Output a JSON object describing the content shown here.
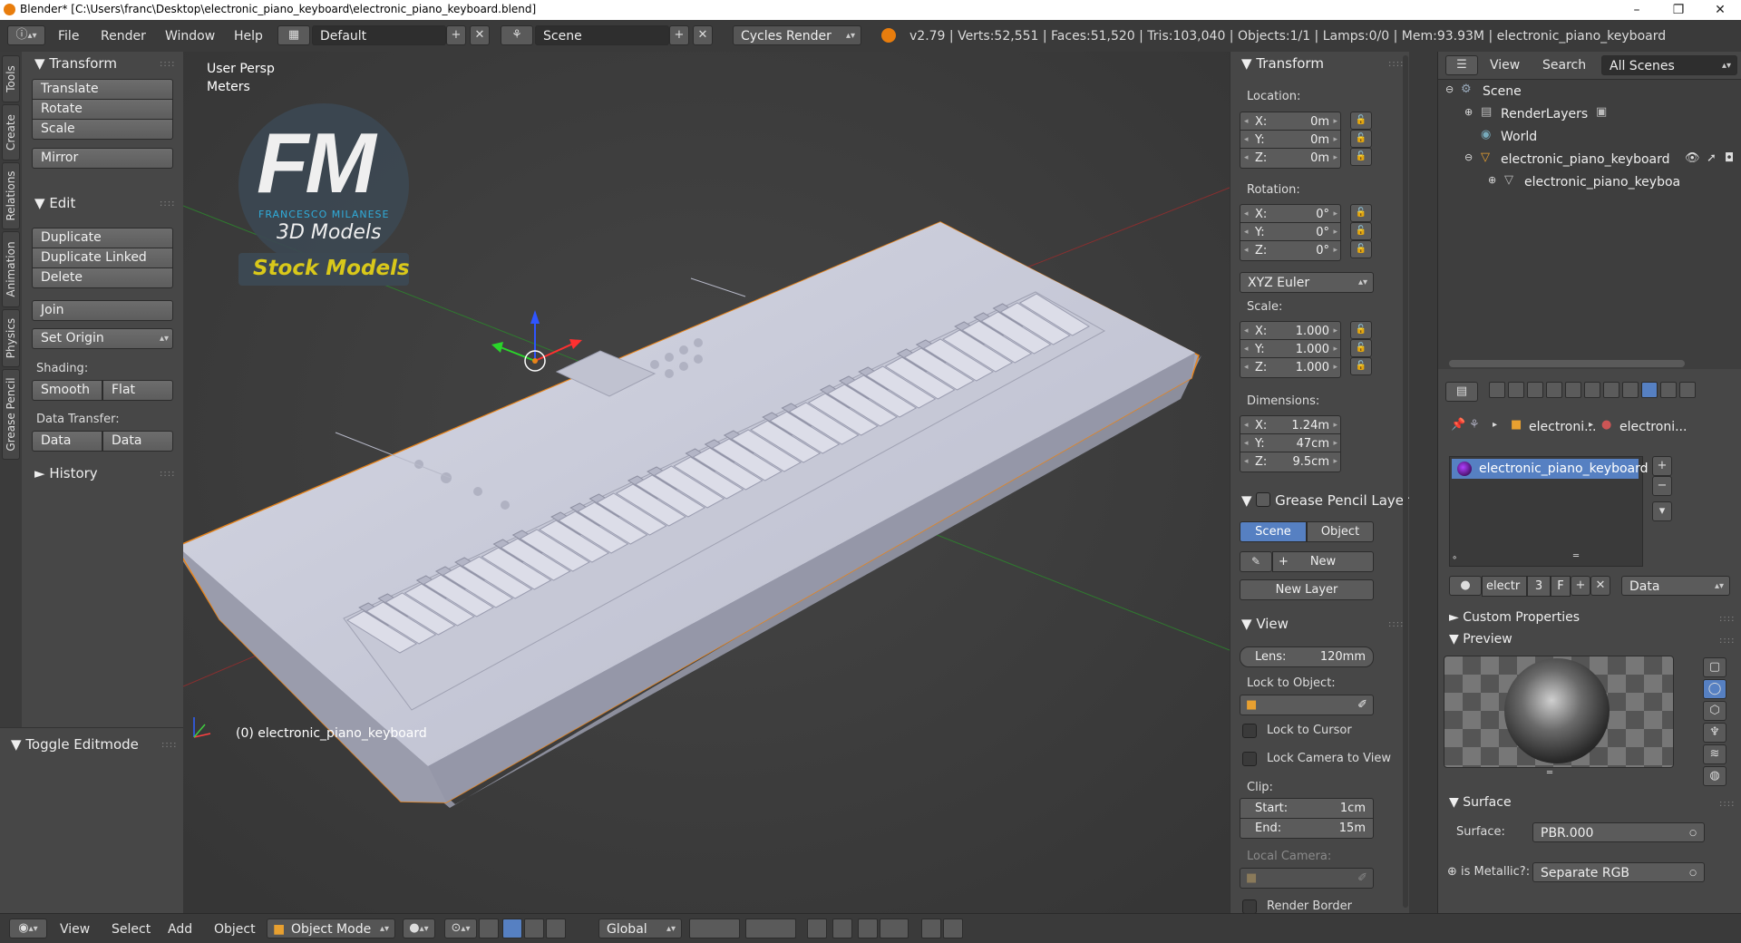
{
  "window": {
    "title": "Blender* [C:\\Users\\franc\\Desktop\\electronic_piano_keyboard\\electronic_piano_keyboard.blend]",
    "controls": [
      "–",
      "❐",
      "✕"
    ]
  },
  "info_header": {
    "menus": [
      "File",
      "Render",
      "Window",
      "Help"
    ],
    "screen_layout": "Default",
    "scene": "Scene",
    "render_engine": "Cycles Render",
    "stats": "v2.79 | Verts:52,551 | Faces:51,520 | Tris:103,040 | Objects:1/1 | Lamps:0/0 | Mem:93.93M | electronic_piano_keyboard"
  },
  "side_tabs": [
    "Tools",
    "Create",
    "Relations",
    "Animation",
    "Physics",
    "Grease Pencil"
  ],
  "tool_shelf": {
    "transform": {
      "title": "Transform",
      "buttons": [
        "Translate",
        "Rotate",
        "Scale",
        "Mirror"
      ]
    },
    "edit": {
      "title": "Edit",
      "buttons": [
        "Duplicate",
        "Duplicate Linked",
        "Delete",
        "Join"
      ],
      "set_origin": "Set Origin",
      "shading_label": "Shading:",
      "shading": [
        "Smooth",
        "Flat"
      ],
      "data_transfer_label": "Data Transfer:",
      "data_transfer": [
        "Data",
        "Data Layo"
      ]
    },
    "history": "History",
    "toggle_editmode": "Toggle Editmode"
  },
  "viewport": {
    "view_name": "User Persp",
    "units": "Meters",
    "object_label": "(0) electronic_piano_keyboard",
    "watermark": {
      "logo": "FM",
      "name": "FRANCESCO MILANESE",
      "sub": "3D Models",
      "tag": "Stock Models"
    }
  },
  "n_panel": {
    "transform_title": "Transform",
    "location_label": "Location:",
    "location": [
      {
        "axis": "X:",
        "value": "0m"
      },
      {
        "axis": "Y:",
        "value": "0m"
      },
      {
        "axis": "Z:",
        "value": "0m"
      }
    ],
    "rotation_label": "Rotation:",
    "rotation": [
      {
        "axis": "X:",
        "value": "0°"
      },
      {
        "axis": "Y:",
        "value": "0°"
      },
      {
        "axis": "Z:",
        "value": "0°"
      }
    ],
    "rotation_mode": "XYZ Euler",
    "scale_label": "Scale:",
    "scale": [
      {
        "axis": "X:",
        "value": "1.000"
      },
      {
        "axis": "Y:",
        "value": "1.000"
      },
      {
        "axis": "Z:",
        "value": "1.000"
      }
    ],
    "dimensions_label": "Dimensions:",
    "dimensions": [
      {
        "axis": "X:",
        "value": "1.24m"
      },
      {
        "axis": "Y:",
        "value": "47cm"
      },
      {
        "axis": "Z:",
        "value": "9.5cm"
      }
    ],
    "grease_title": "Grease Pencil Layer",
    "grease_tabs": [
      "Scene",
      "Object"
    ],
    "grease_new": "New",
    "grease_new_layer": "New Layer",
    "view_title": "View",
    "lens_label": "Lens:",
    "lens_value": "120mm",
    "lock_object_label": "Lock to Object:",
    "lock_cursor": "Lock to Cursor",
    "lock_camera": "Lock Camera to View",
    "clip_label": "Clip:",
    "clip_start_label": "Start:",
    "clip_start": "1cm",
    "clip_end_label": "End:",
    "clip_end": "15m",
    "local_camera": "Local Camera:",
    "render_border": "Render Border"
  },
  "outliner": {
    "menus": [
      "View",
      "Search"
    ],
    "filter": "All Scenes",
    "items": [
      "Scene",
      "RenderLayers",
      "World",
      "electronic_piano_keyboard",
      "electronic_piano_keyboa"
    ]
  },
  "properties": {
    "breadcrumb": [
      "electroni...",
      "electroni..."
    ],
    "material_slot": "electronic_piano_keyboard",
    "mat_name": "electr",
    "mat_users": "3",
    "mat_fake": "F",
    "link_mode": "Data",
    "custom_props": "Custom Properties",
    "preview": "Preview",
    "surface_title": "Surface",
    "surface_label": "Surface:",
    "surface_value": "PBR.000",
    "metallic_label": "is Metallic?:",
    "metallic_value": "Separate RGB"
  },
  "bottom_header": {
    "menus": [
      "View",
      "Select",
      "Add",
      "Object"
    ],
    "mode": "Object Mode",
    "orientation": "Global"
  },
  "colors": {
    "accent_blue": "#5680c2",
    "selection_orange": "#e8841a",
    "viewport_bg": "#3f3f3f"
  }
}
